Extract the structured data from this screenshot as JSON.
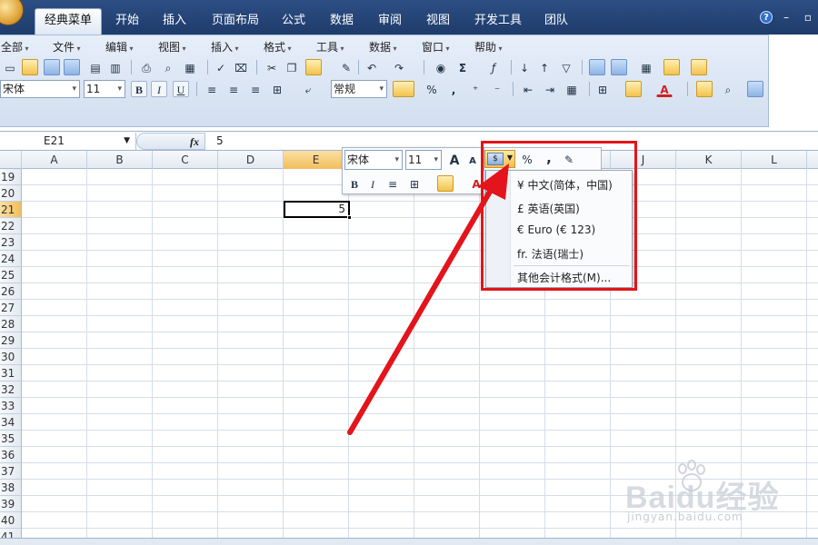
{
  "ribbon": {
    "tabs": [
      "经典菜单",
      "开始",
      "插入",
      "页面布局",
      "公式",
      "数据",
      "审阅",
      "视图",
      "开发工具",
      "团队"
    ],
    "active_tab": "经典菜单"
  },
  "menubar": {
    "items": [
      "全部",
      "文件",
      "编辑",
      "视图",
      "插入",
      "格式",
      "工具",
      "数据",
      "窗口",
      "帮助"
    ]
  },
  "format_toolbar": {
    "font": "宋体",
    "font_size": "11",
    "bold": "B",
    "italic": "I",
    "underline": "U",
    "number_format": "常规",
    "percent": "%",
    "comma": ","
  },
  "formula_bar": {
    "name_box": "E21",
    "fx_label": "fx",
    "value": "5"
  },
  "grid": {
    "columns": [
      "A",
      "B",
      "C",
      "D",
      "E",
      "F",
      "G",
      "H",
      "I",
      "J",
      "K",
      "L"
    ],
    "selected_column": "E",
    "rows": [
      "19",
      "20",
      "21",
      "22",
      "23",
      "24",
      "25",
      "26",
      "27",
      "28",
      "29",
      "30",
      "31",
      "32",
      "33",
      "34",
      "35",
      "36",
      "37",
      "38",
      "39",
      "40",
      "41"
    ],
    "selected_row": "21",
    "active_cell_value": "5"
  },
  "mini_toolbar": {
    "font": "宋体",
    "font_size": "11",
    "grow": "A",
    "shrink": "A",
    "bold": "B",
    "italic": "I",
    "font_color": "A",
    "percent": "%",
    "comma": ","
  },
  "accounting_menu": {
    "items": [
      "¥ 中文(简体，中国)",
      "£ 英语(英国)",
      "€ Euro (€ 123)",
      "fr. 法语(瑞士)"
    ],
    "more": "其他会计格式(M)..."
  },
  "watermark": {
    "logo": "Baidu经验",
    "url": "jingyan.baidu.com"
  },
  "colors": {
    "highlight": "#e3141b",
    "ribbon": "#1e3b6a",
    "selected_header": "#f2bd5c"
  }
}
